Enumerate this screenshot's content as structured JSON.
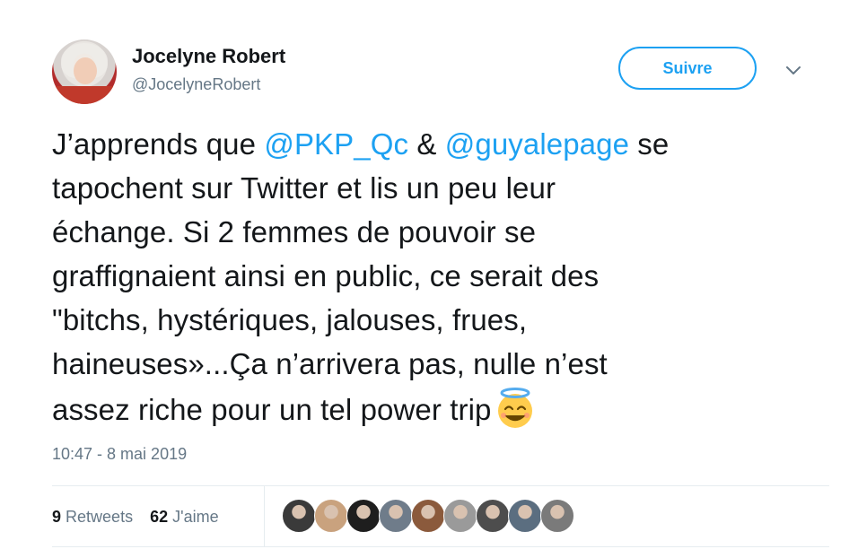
{
  "author": {
    "name": "Jocelyne Robert",
    "handle": "@JocelyneRobert"
  },
  "follow_button": {
    "label": "Suivre"
  },
  "tweet": {
    "lines": [
      {
        "parts": [
          {
            "text": "J’apprends que ",
            "mention": false
          },
          {
            "text": "@PKP_Qc",
            "mention": true
          },
          {
            "text": " & ",
            "mention": false
          },
          {
            "text": "@guyalepage",
            "mention": true
          },
          {
            "text": " se",
            "mention": false
          }
        ]
      },
      {
        "parts": [
          {
            "text": "tapochent sur Twitter et lis un peu leur",
            "mention": false
          }
        ]
      },
      {
        "parts": [
          {
            "text": "échange. Si 2 femmes de pouvoir se",
            "mention": false
          }
        ]
      },
      {
        "parts": [
          {
            "text": "graffignaient ainsi en public, ce serait des",
            "mention": false
          }
        ]
      },
      {
        "parts": [
          {
            "text": "\"bitchs, hystériques, jalouses, frues,",
            "mention": false
          }
        ]
      },
      {
        "parts": [
          {
            "text": "haineuses»...Ça n’arrivera pas, nulle n’est",
            "mention": false
          }
        ]
      },
      {
        "parts": [
          {
            "text": "assez riche pour un tel power trip",
            "mention": false
          }
        ]
      }
    ],
    "emoji": "smiling-face-with-halo-icon"
  },
  "timestamp": "10:47 - 8 mai 2019",
  "stats": {
    "retweets_count": "9",
    "retweets_label": "Retweets",
    "likes_count": "62",
    "likes_label": "J'aime"
  },
  "likers": [
    {
      "icon": "liker-avatar-1",
      "color": "#3a3a3a"
    },
    {
      "icon": "liker-avatar-2",
      "color": "#c9a27e"
    },
    {
      "icon": "liker-avatar-3",
      "color": "#1e1e1e"
    },
    {
      "icon": "liker-avatar-4",
      "color": "#6f7c8a"
    },
    {
      "icon": "liker-avatar-5",
      "color": "#8b5a3c"
    },
    {
      "icon": "liker-avatar-6",
      "color": "#9a9a9a"
    },
    {
      "icon": "liker-avatar-7",
      "color": "#4d4d4d"
    },
    {
      "icon": "liker-avatar-8",
      "color": "#5b6e80"
    },
    {
      "icon": "liker-avatar-9",
      "color": "#7a7a7a"
    }
  ],
  "colors": {
    "accent": "#1da1f2",
    "text": "#14171a",
    "muted": "#657786",
    "divider": "#e6ecf0"
  }
}
